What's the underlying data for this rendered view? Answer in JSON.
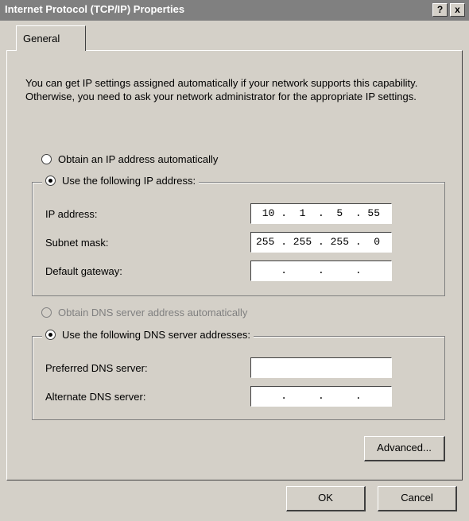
{
  "window": {
    "title": "Internet Protocol (TCP/IP) Properties",
    "help_label": "?",
    "close_label": "x"
  },
  "tab": {
    "label": "General"
  },
  "description": "You can get IP settings assigned automatically if your network supports this capability. Otherwise, you need to ask your network administrator for the appropriate IP settings.",
  "ip_section": {
    "obtain_auto_label": "Obtain an IP address automatically",
    "use_following_label": "Use the following IP address:",
    "selected": "use_following",
    "fields": [
      {
        "label": "IP address:",
        "value": " 10 .  1  .  5  . 55"
      },
      {
        "label": "Subnet mask:",
        "value": "255 . 255 . 255 .  0"
      },
      {
        "label": "Default gateway:",
        "value": "    .     .     .   "
      }
    ]
  },
  "dns_section": {
    "obtain_auto_label": "Obtain DNS server address automatically",
    "obtain_auto_disabled": true,
    "use_following_label": "Use the following DNS server addresses:",
    "selected": "use_following",
    "fields": [
      {
        "label": "Preferred DNS server:",
        "value": ""
      },
      {
        "label": "Alternate DNS server:",
        "value": "    .     .     .   "
      }
    ]
  },
  "buttons": {
    "advanced": "Advanced...",
    "ok": "OK",
    "cancel": "Cancel"
  },
  "colors": {
    "face": "#d4d0c8",
    "titlebar": "#808080",
    "title_text": "#ffffff"
  }
}
